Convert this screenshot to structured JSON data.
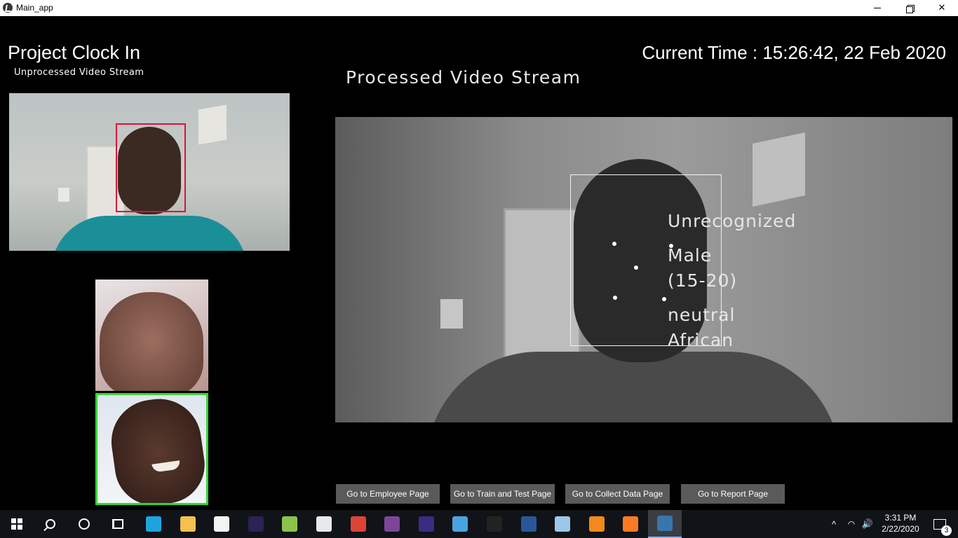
{
  "window": {
    "title": "Main_app",
    "minimize_glyph": "",
    "close_glyph": "✕"
  },
  "header": {
    "project_title": "Project Clock In",
    "unprocessed_label": "Unprocessed Video Stream",
    "current_time": "Current Time : 15:26:42, 22 Feb 2020",
    "processed_label": "Processed Video Stream"
  },
  "detection": {
    "name": "Unrecognized",
    "gender": "Male",
    "age_range": "(15-20)",
    "emotion": "neutral",
    "race": "African",
    "face_box_color": "#e0103a",
    "selected_thumbnail_border": "#33d633"
  },
  "buttons": {
    "employee": "Go to Employee Page",
    "train_test": "Go to Train and Test Page",
    "collect_data": "Go to Collect Data Page",
    "report": "Go to Report Page"
  },
  "taskbar": {
    "apps": [
      {
        "icon": "internet-explorer-icon",
        "color": "#1fa3e0"
      },
      {
        "icon": "file-explorer-icon",
        "color": "#f2c14e"
      },
      {
        "icon": "microsoft-store-icon",
        "color": "#f3f3f3"
      },
      {
        "icon": "eclipse-icon",
        "color": "#2c2255"
      },
      {
        "icon": "notepad-plus-icon",
        "color": "#8bc34a"
      },
      {
        "icon": "mail-icon",
        "color": "#e9e9e9"
      },
      {
        "icon": "chrome-icon",
        "color": "#db4437"
      },
      {
        "icon": "tor-browser-icon",
        "color": "#7d4698"
      },
      {
        "icon": "eclipse-ide-icon",
        "color": "#3b2c82"
      },
      {
        "icon": "control-panel-icon",
        "color": "#4aa3df"
      },
      {
        "icon": "command-prompt-icon",
        "color": "#222222"
      },
      {
        "icon": "word-icon",
        "color": "#2b579a"
      },
      {
        "icon": "virtualbox-icon",
        "color": "#9cc7e8"
      },
      {
        "icon": "vlc-icon",
        "color": "#f08a1c"
      },
      {
        "icon": "xampp-icon",
        "color": "#fb7a24"
      },
      {
        "icon": "python-icon",
        "color": "#3776ab"
      }
    ],
    "tray": {
      "chevron": "^",
      "wifi": "◠",
      "volume": "🔊",
      "time": "3:31 PM",
      "date": "2/22/2020",
      "notification_count": "3"
    }
  }
}
